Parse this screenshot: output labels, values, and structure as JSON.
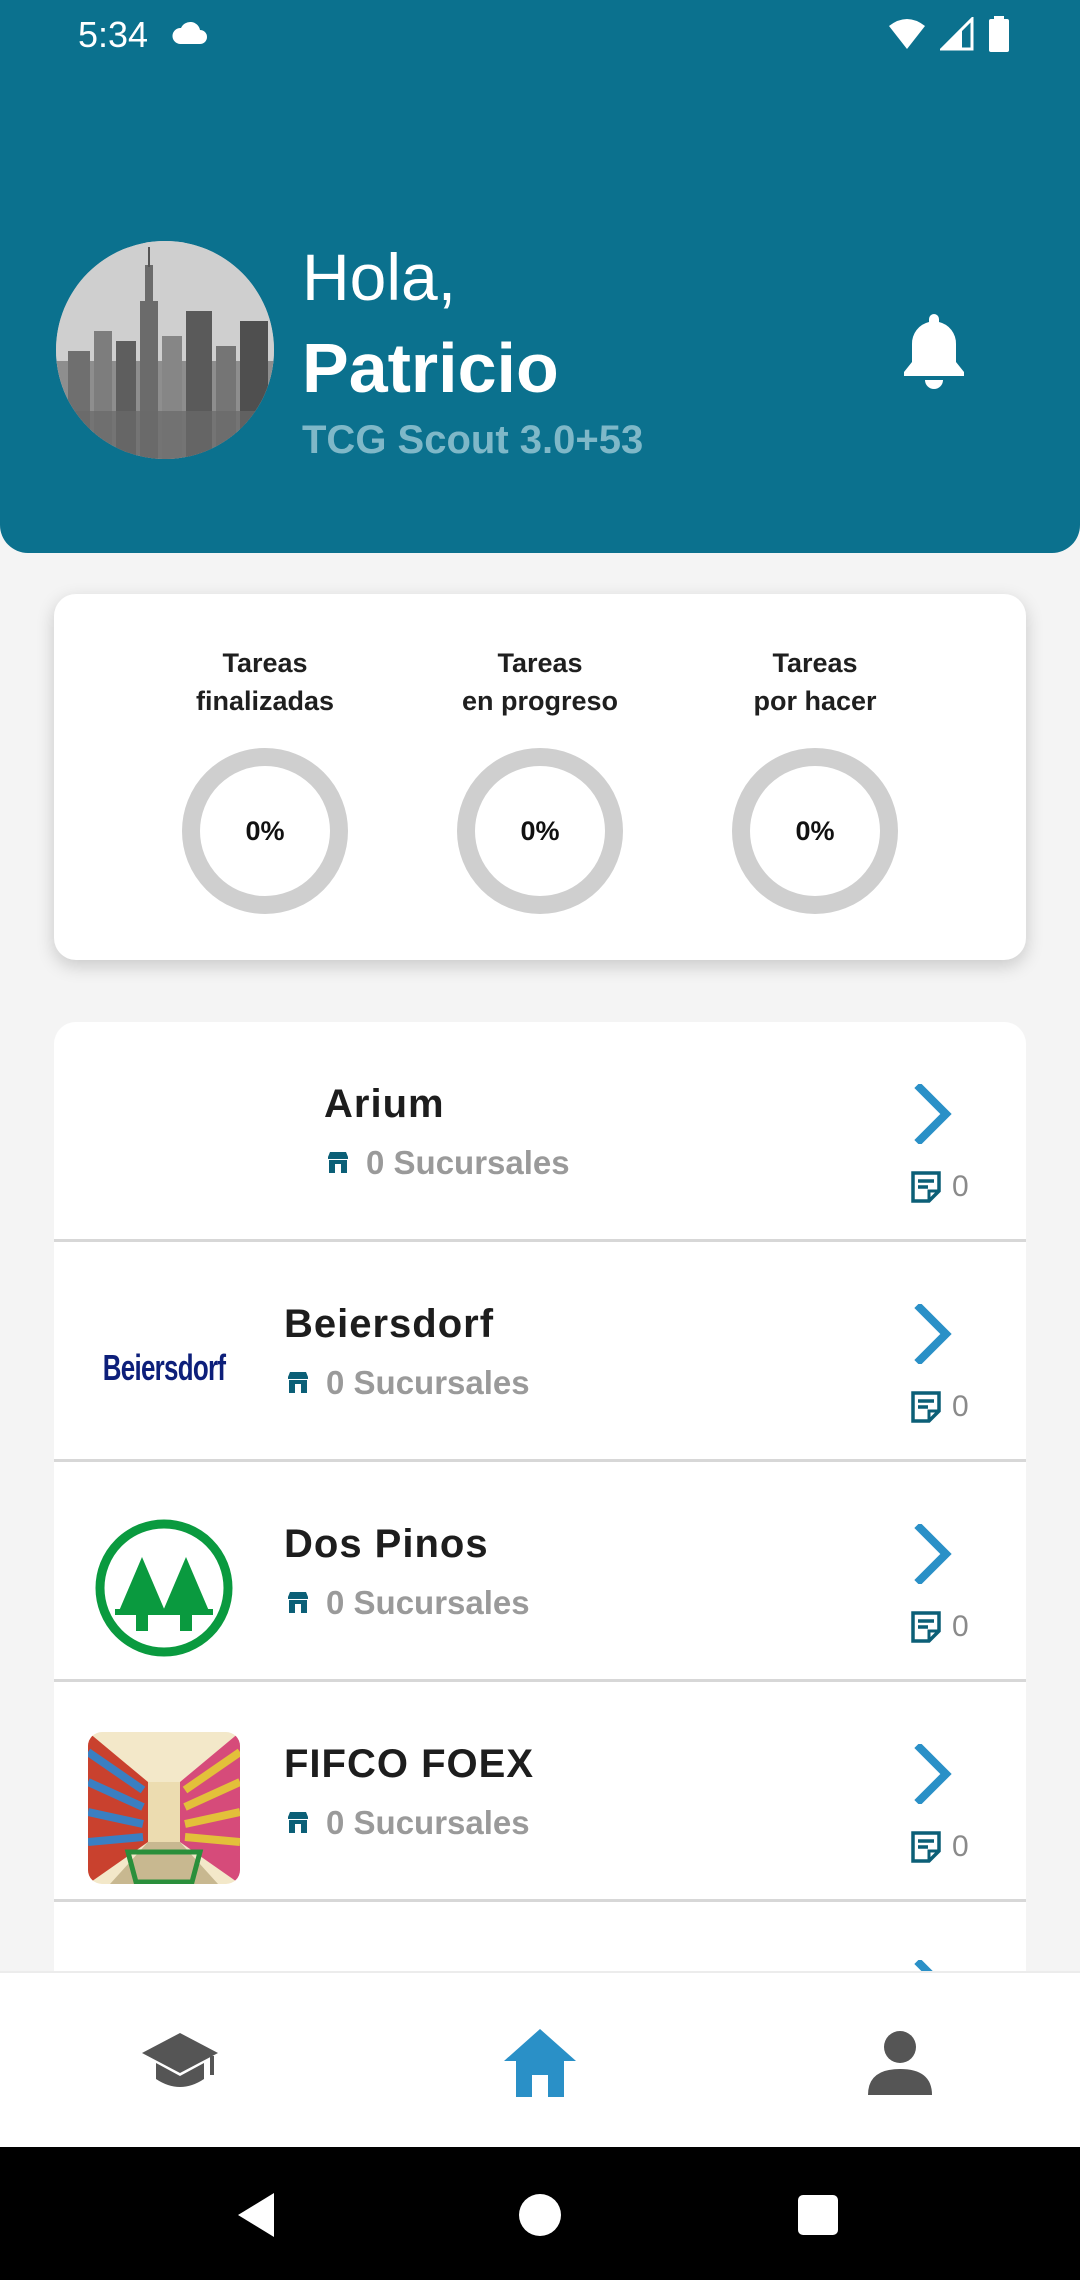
{
  "status_bar": {
    "time": "5:34"
  },
  "header": {
    "greeting": "Hola,",
    "user_name": "Patricio",
    "app_version": "TCG Scout 3.0+53"
  },
  "stats": [
    {
      "label_line1": "Tareas",
      "label_line2": "finalizadas",
      "percent_text": "0%",
      "value": 0
    },
    {
      "label_line1": "Tareas",
      "label_line2": "en progreso",
      "percent_text": "0%",
      "value": 0
    },
    {
      "label_line1": "Tareas",
      "label_line2": "por hacer",
      "percent_text": "0%",
      "value": 0
    }
  ],
  "companies": [
    {
      "name": "Arium",
      "branches": "0 Sucursales",
      "tasks": "0"
    },
    {
      "name": "Beiersdorf",
      "branches": "0 Sucursales",
      "tasks": "0",
      "logo_text": "Beiersdorf"
    },
    {
      "name": "Dos Pinos",
      "branches": "0 Sucursales",
      "tasks": "0"
    },
    {
      "name": "FIFCO FOEX",
      "branches": "0 Sucursales",
      "tasks": "0"
    }
  ],
  "nav": {
    "items": [
      "graduation-cap-icon",
      "home-icon",
      "person-icon"
    ],
    "active_color": "#2a90c7",
    "inactive_color": "#555555"
  },
  "colors": {
    "header_bg": "#0b718e",
    "accent": "#2a90c7",
    "ring": "#cfcfcf"
  }
}
